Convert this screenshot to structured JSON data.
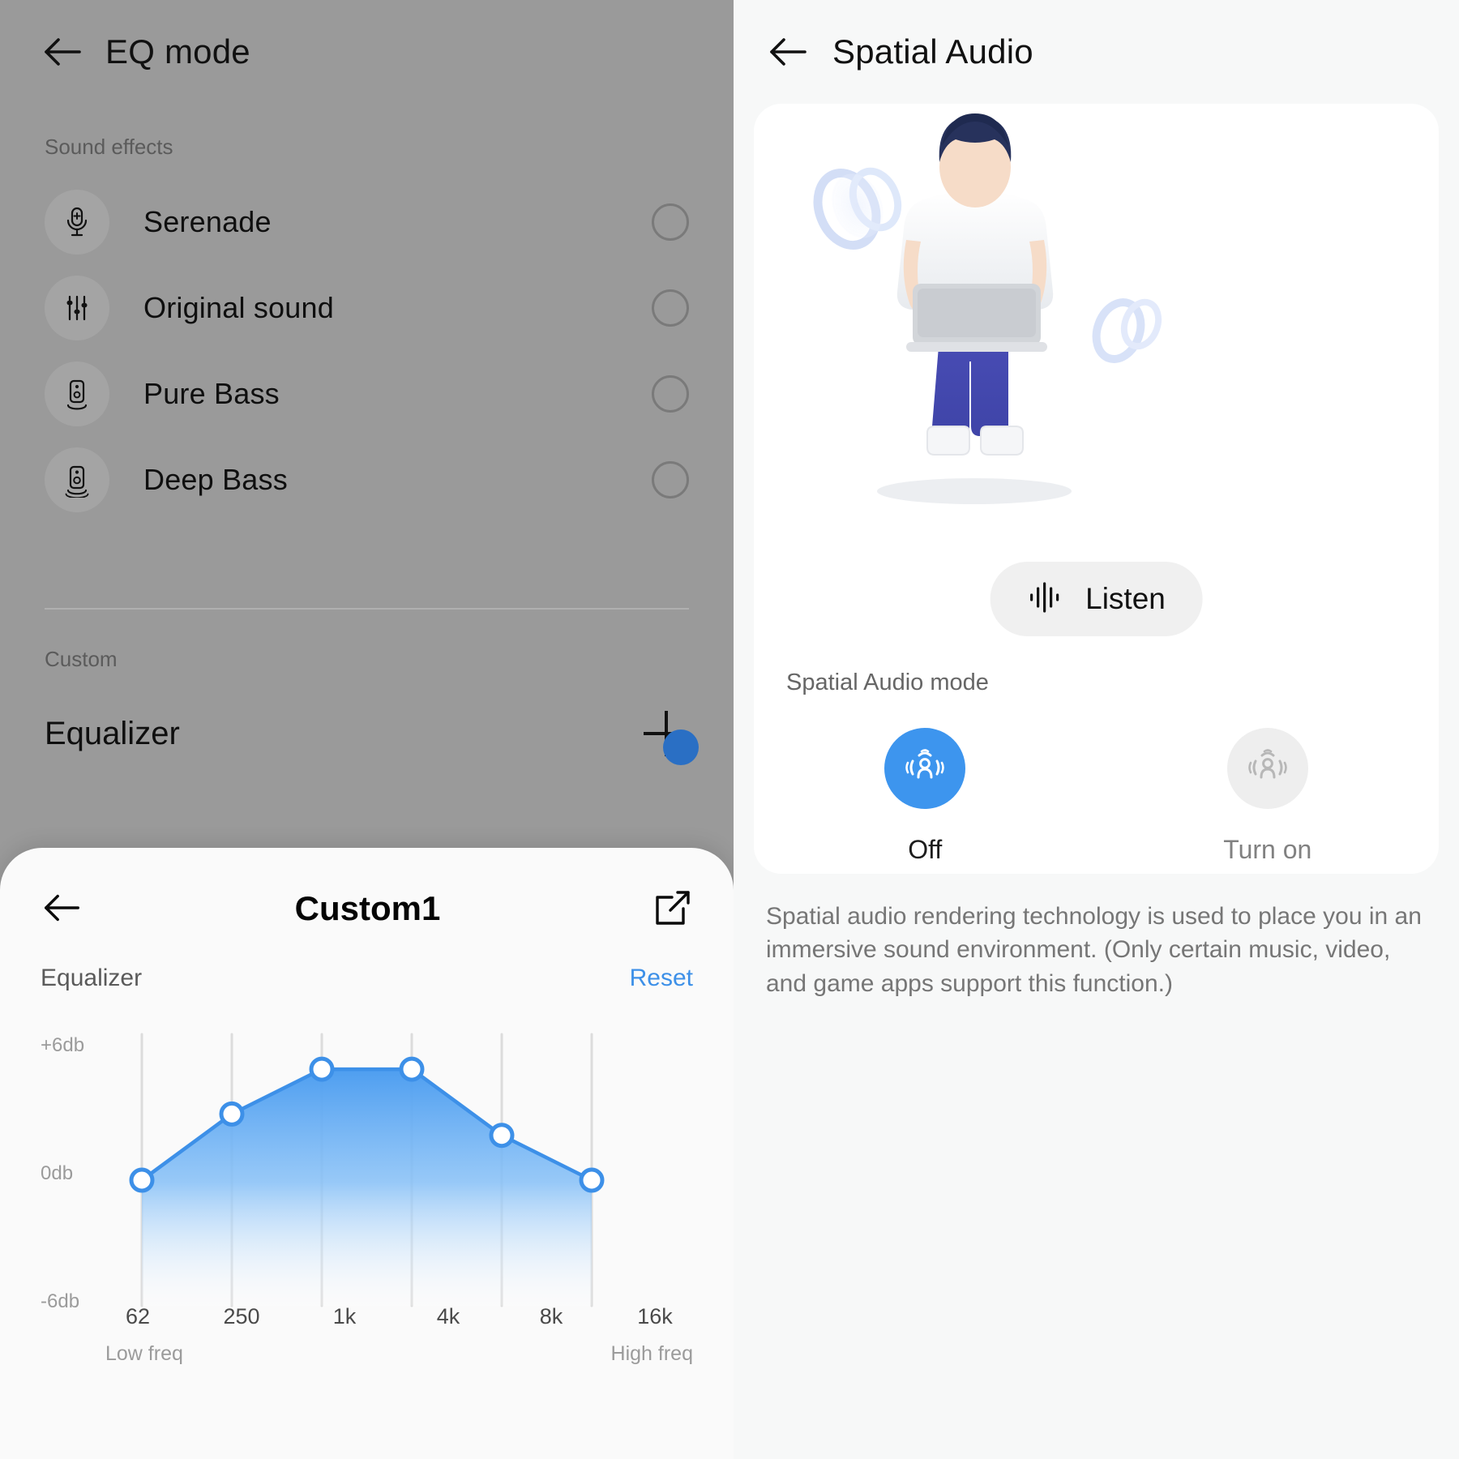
{
  "left": {
    "header": {
      "title": "EQ mode",
      "back_icon": "arrow-left-icon"
    },
    "sound_effects_label": "Sound effects",
    "sound_effects": [
      {
        "label": "Serenade",
        "icon": "microphone-plus-icon",
        "selected": false
      },
      {
        "label": "Original sound",
        "icon": "sliders-icon",
        "selected": false
      },
      {
        "label": "Pure Bass",
        "icon": "speaker-icon",
        "selected": false
      },
      {
        "label": "Deep Bass",
        "icon": "speaker-deep-icon",
        "selected": false
      }
    ],
    "custom_label": "Custom",
    "equalizer_title": "Equalizer",
    "add_icon": "plus-icon"
  },
  "sheet": {
    "back_icon": "arrow-left-icon",
    "title": "Custom1",
    "edit_icon": "edit-pencil-icon",
    "equalizer_label": "Equalizer",
    "reset_label": "Reset",
    "low_freq_label": "Low freq",
    "high_freq_label": "High freq",
    "accent_color": "#3d90e8"
  },
  "chart_data": {
    "type": "line",
    "title": "Equalizer",
    "xlabel": "",
    "ylabel": "",
    "categories": [
      "62",
      "250",
      "1k",
      "4k",
      "8k",
      "16k"
    ],
    "values": [
      0,
      3.1,
      5.2,
      5.2,
      2.1,
      0
    ],
    "ytick_labels": [
      "+6db",
      "0db",
      "-6db"
    ],
    "ytick_values": [
      6,
      0,
      -6
    ],
    "ylim": [
      -6,
      6
    ],
    "grid": true,
    "legend": "none",
    "annotations": [
      "Low freq",
      "High freq"
    ],
    "series": [
      {
        "name": "Custom1",
        "values": [
          0,
          3.1,
          5.2,
          5.2,
          2.1,
          0
        ]
      }
    ],
    "line_color": "#3d90e8",
    "fill_gradient": [
      "#5aa6f0",
      "#ffffff"
    ]
  },
  "right": {
    "header": {
      "title": "Spatial Audio",
      "back_icon": "arrow-left-icon"
    },
    "illustration": "person-with-laptop-spatial-audio-illustration",
    "listen_button": {
      "label": "Listen",
      "icon": "audio-waveform-icon"
    },
    "mode_section_label": "Spatial Audio mode",
    "modes": [
      {
        "label": "Off",
        "icon": "spatial-audio-icon",
        "active": true,
        "color": "#3d95ee"
      },
      {
        "label": "Turn on",
        "icon": "spatial-audio-icon",
        "active": false,
        "color": "#eeeeee"
      }
    ],
    "description": "Spatial audio rendering technology is used to place you in an immersive sound environment. (Only certain music, video, and game apps support this function.)"
  }
}
